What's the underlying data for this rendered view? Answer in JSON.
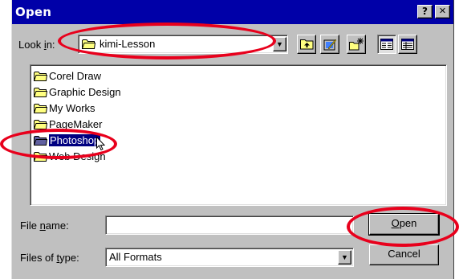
{
  "window": {
    "title": "Open",
    "help_label": "?",
    "close_label": "✕"
  },
  "look_in": {
    "label_prefix": "Look ",
    "label_mnemonic": "i",
    "label_suffix": "n:",
    "value": "kimi-Lesson",
    "folder_icon": "folder-icon"
  },
  "toolbar": {
    "up_icon": "up-one-level-icon",
    "desktop_icon": "desktop-icon",
    "new_folder_icon": "new-folder-icon",
    "list_icon": "list-view-icon",
    "details_icon": "details-view-icon"
  },
  "file_list": {
    "items": [
      {
        "name": "Corel Draw"
      },
      {
        "name": "Graphic Design"
      },
      {
        "name": "My Works"
      },
      {
        "name": "PageMaker"
      },
      {
        "name": "Photoshop"
      },
      {
        "name": "Web Design"
      }
    ],
    "selected_index": 4
  },
  "file_name": {
    "label_prefix": "File ",
    "label_mnemonic": "n",
    "label_suffix": "ame:",
    "value": ""
  },
  "file_type": {
    "label_prefix": "Files of ",
    "label_mnemonic": "t",
    "label_suffix": "ype:",
    "value": "All Formats"
  },
  "buttons": {
    "open_mnemonic": "O",
    "open_rest": "pen",
    "cancel_label": "Cancel"
  },
  "colors": {
    "title_bar": "#0000a8",
    "dialog_face": "#c0c0c0",
    "selection": "#000080",
    "annotation_ellipse": "#e8001c",
    "folder_yellow": "#ffff80"
  }
}
